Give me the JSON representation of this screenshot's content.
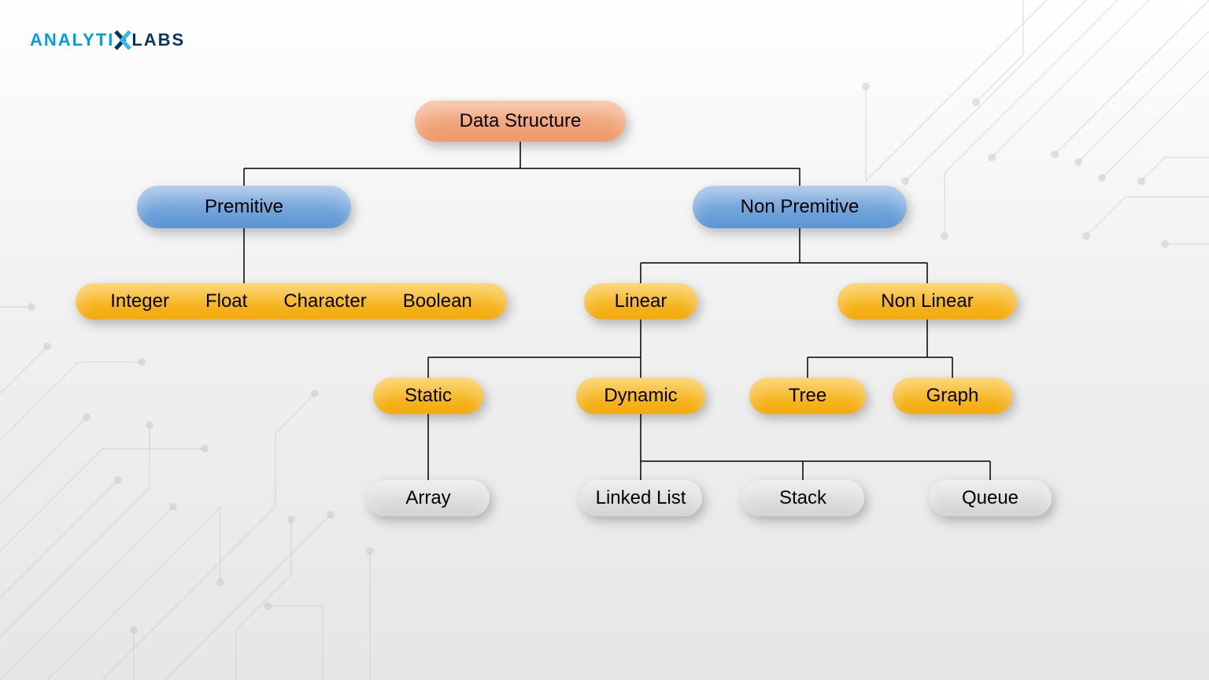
{
  "logo": {
    "part1": "ANALYTI",
    "part2": "LABS"
  },
  "root": {
    "label": "Data Structure"
  },
  "primitive": {
    "label": "Premitive"
  },
  "nonprimitive": {
    "label": "Non Premitive"
  },
  "primitive_types": {
    "integer": "Integer",
    "float": "Float",
    "character": "Character",
    "boolean": "Boolean"
  },
  "linear": {
    "label": "Linear"
  },
  "nonlinear": {
    "label": "Non Linear"
  },
  "static": {
    "label": "Static"
  },
  "dynamic": {
    "label": "Dynamic"
  },
  "tree": {
    "label": "Tree"
  },
  "graph": {
    "label": "Graph"
  },
  "array": {
    "label": "Array"
  },
  "linkedlist": {
    "label": "Linked List"
  },
  "stack": {
    "label": "Stack"
  },
  "queue": {
    "label": "Queue"
  },
  "colors": {
    "root": "#ee9a6b",
    "category": "#5b94d4",
    "sub": "#f2aa0c",
    "leaf": "#d4d4d4"
  }
}
